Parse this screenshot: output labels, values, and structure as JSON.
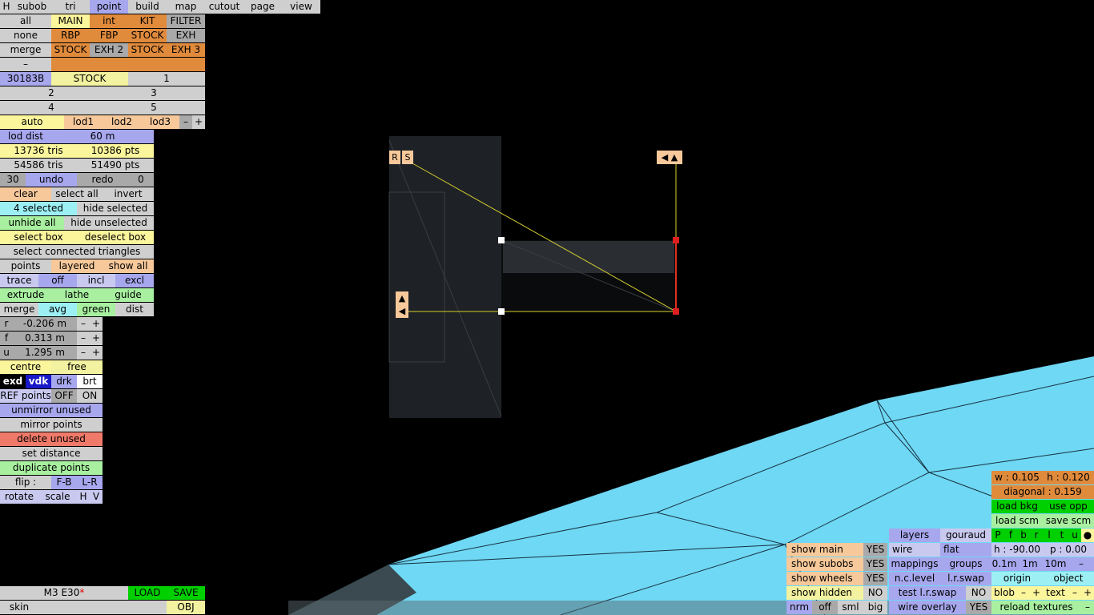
{
  "top_menu": [
    "H",
    "subob",
    "tri",
    "point",
    "build",
    "map",
    "cutout",
    "page",
    "view"
  ],
  "selection": {
    "all": "all",
    "none": "none",
    "merge": "merge",
    "dash": "–",
    "main": "MAIN",
    "int": "int",
    "kit": "KIT",
    "filter": "FILTER",
    "rbp": "RBP",
    "fbp": "FBP",
    "stock1": "STOCK",
    "exh": "EXH",
    "stock2": "STOCK",
    "exh2": "EXH 2",
    "stock3": "STOCK",
    "exh3": "EXH 3"
  },
  "id_row": {
    "id": "30183B",
    "stock": "STOCK",
    "one": "1"
  },
  "num_rows": {
    "n2": "2",
    "n3": "3",
    "n4": "4",
    "n5": "5"
  },
  "lod": {
    "auto": "auto",
    "lod1": "lod1",
    "lod2": "lod2",
    "lod3": "lod3",
    "minus": "–",
    "plus": "+"
  },
  "lod_dist": {
    "label": "lod dist",
    "value": "60 m"
  },
  "stats": {
    "tris1": "13736 tris",
    "pts1": "10386 pts",
    "tris2": "54586 tris",
    "pts2": "51490 pts"
  },
  "undo_row": {
    "count": "30",
    "undo": "undo",
    "redo": "redo",
    "redo_count": "0"
  },
  "edit": {
    "clear": "clear",
    "select_all": "select all",
    "invert": "invert",
    "selected": "4 selected",
    "hide_selected": "hide selected",
    "unhide_all": "unhide all",
    "hide_unselected": "hide unselected",
    "select_box": "select box",
    "deselect_box": "deselect box",
    "select_connected": "select connected triangles",
    "points": "points",
    "layered": "layered",
    "show_all": "show all",
    "trace": "trace",
    "off": "off",
    "incl": "incl",
    "excl": "excl",
    "extrude": "extrude",
    "lathe": "lathe",
    "guide": "guide",
    "merge": "merge",
    "avg": "avg",
    "green": "green",
    "dist": "dist"
  },
  "coords": [
    {
      "axis": "r",
      "value": "-0.206 m"
    },
    {
      "axis": "f",
      "value": "0.313 m"
    },
    {
      "axis": "u",
      "value": "1.295 m"
    }
  ],
  "pm": {
    "minus": "–",
    "plus": "+"
  },
  "pivot": {
    "centre": "centre",
    "free": "free"
  },
  "shade": {
    "exd": "exd",
    "vdk": "vdk",
    "drk": "drk",
    "brt": "brt"
  },
  "ref": {
    "label": "REF points",
    "off": "OFF",
    "on": "ON"
  },
  "ops": {
    "unmirror": "unmirror unused",
    "mirror": "mirror points",
    "delete": "delete unused",
    "set_distance": "set distance",
    "duplicate": "duplicate points",
    "flip": "flip :",
    "fb": "F-B",
    "lr": "L-R",
    "rotate": "rotate",
    "scale": "scale",
    "h": "H",
    "v": "V"
  },
  "file": {
    "model": "M3 E30",
    "modified_mark": "*",
    "load": "LOAD",
    "save": "SAVE",
    "skin": "skin",
    "obj": "OBJ"
  },
  "viewport": {
    "handle_r": "R",
    "handle_s": "S",
    "arrows_h": "◀ ▲",
    "arrows_v1": "▲",
    "arrows_v2": "◀"
  },
  "right_panel": {
    "w": "w : 0.105",
    "h": "h : 0.120",
    "diagonal": "diagonal : 0.159",
    "load_bkg": "load bkg",
    "use_opp": "use opp",
    "load_scm": "load scm",
    "save_scm": "save scm",
    "letters": [
      "P",
      "f",
      "b",
      "r",
      "l",
      "t",
      "u",
      "●"
    ],
    "heading": "h : -90.00",
    "pitch": "p : 0.00",
    "step1": "0.1m",
    "step2": "1m",
    "step3": "10m",
    "step_minus": "–",
    "origin": "origin",
    "object": "object",
    "blob": "blob",
    "text": "text",
    "minus": "–",
    "plus": "+",
    "reload": "reload textures"
  },
  "display": {
    "layers": "layers",
    "gouraud": "gouraud",
    "wire": "wire",
    "flat": "flat",
    "mappings": "mappings",
    "groups": "groups",
    "nclevel": "n.c.level",
    "lrswap": "l.r.swap",
    "test_lrswap": "test l.r.swap",
    "wire_overlay": "wire overlay",
    "show_main": "show main",
    "show_subobs": "show subobs",
    "show_wheels": "show wheels",
    "show_hidden": "show hidden",
    "yes": "YES",
    "no": "NO",
    "nrm": "nrm",
    "off": "off",
    "sml": "sml",
    "big": "big"
  }
}
